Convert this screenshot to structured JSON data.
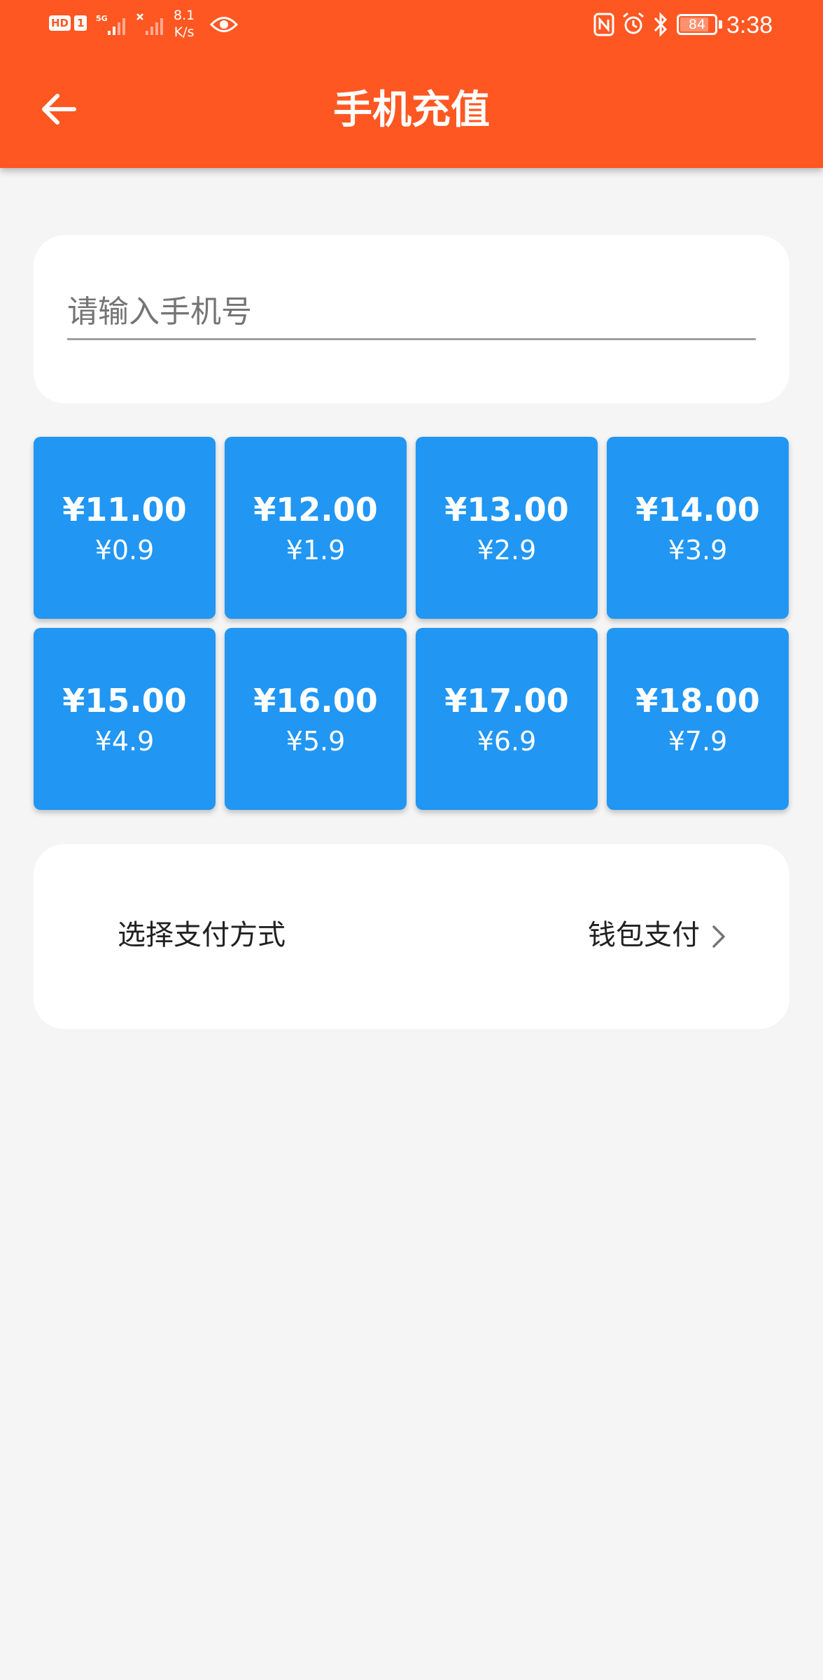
{
  "status_bar": {
    "hd_badge": "HD",
    "sim_badge": "1",
    "network_5g": "5G",
    "speed_value": "8.1",
    "speed_unit": "K/s",
    "battery_level": "84",
    "time": "3:38"
  },
  "app_bar": {
    "title": "手机充值",
    "back_icon": "arrow-left-icon",
    "color": "#ff5722"
  },
  "phone_field": {
    "placeholder": "请输入手机号",
    "value": ""
  },
  "recharge_options": [
    {
      "amount": "¥11.00",
      "price": "¥0.9"
    },
    {
      "amount": "¥12.00",
      "price": "¥1.9"
    },
    {
      "amount": "¥13.00",
      "price": "¥2.9"
    },
    {
      "amount": "¥14.00",
      "price": "¥3.9"
    },
    {
      "amount": "¥15.00",
      "price": "¥4.9"
    },
    {
      "amount": "¥16.00",
      "price": "¥5.9"
    },
    {
      "amount": "¥17.00",
      "price": "¥6.9"
    },
    {
      "amount": "¥18.00",
      "price": "¥7.9"
    }
  ],
  "tile_color": "#2196f3",
  "payment": {
    "label": "选择支付方式",
    "value": "钱包支付",
    "chevron_icon": "chevron-right-icon"
  }
}
